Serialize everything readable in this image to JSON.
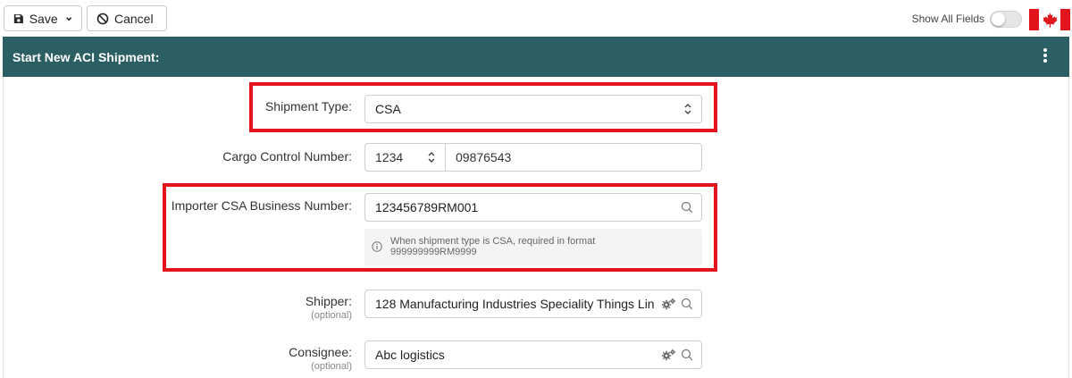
{
  "toolbar": {
    "save_label": "Save",
    "cancel_label": "Cancel",
    "show_all_fields_label": "Show All Fields",
    "show_all_fields_on": false
  },
  "header": {
    "title": "Start New ACI Shipment:"
  },
  "form": {
    "shipment_type": {
      "label": "Shipment Type:",
      "value": "CSA"
    },
    "cargo_control_number": {
      "label": "Cargo Control Number:",
      "prefix": "1234",
      "number": "09876543"
    },
    "importer_csa_business_number": {
      "label": "Importer CSA Business Number:",
      "value": "123456789RM001",
      "hint_line1": "When shipment type is CSA, required in format",
      "hint_line2": "999999999RM9999"
    },
    "shipper": {
      "label": "Shipper:",
      "optional": "(optional)",
      "value": "128 Manufacturing Industries Speciality Things Lin"
    },
    "consignee": {
      "label": "Consignee:",
      "optional": "(optional)",
      "value": "Abc logistics"
    }
  },
  "colors": {
    "header_bg": "#2b5f63",
    "highlight": "#e3151c",
    "flag_red": "#e3151c"
  },
  "icons": [
    "floppy-disk-icon",
    "chevron-down-icon",
    "prohibit-icon",
    "toggle-switch",
    "canada-flag-icon",
    "kebab-menu-icon",
    "updown-chevron-icon",
    "search-icon",
    "gears-icon",
    "info-icon"
  ]
}
